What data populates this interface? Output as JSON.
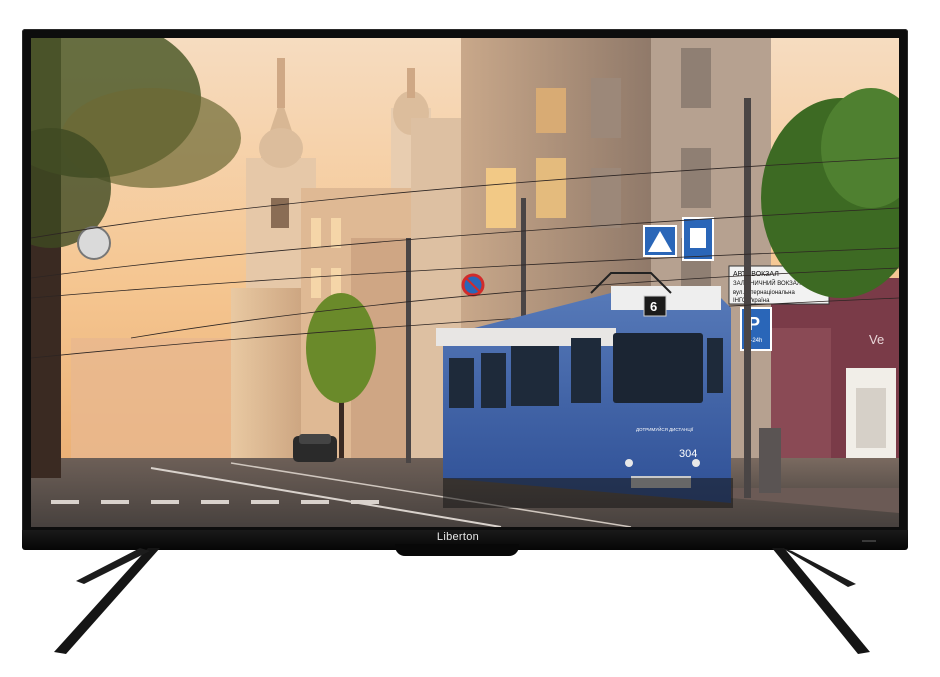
{
  "tv": {
    "brand": "Liberton"
  },
  "scene": {
    "tram_route": "6",
    "tram_number": "304",
    "tram_notice": "ДОТРИМУЙСЯ ДИСТАНЦІЇ",
    "street_sign_line1": "АВТОВОКЗАЛ",
    "street_sign_line2": "ЗАЛІЗНИЧНИЙ ВОКЗАЛ",
    "street_sign_line3": "вул. Інтернаціональна",
    "street_sign_line4": "ІНГО Україна",
    "parking_sign": "P",
    "parking_hours": "0-24h",
    "shop_sign": "Ve"
  },
  "colors": {
    "bezel": "#0d0d0d",
    "tram_blue": "#3a63a8",
    "sky_warm": "#f4c38a"
  }
}
